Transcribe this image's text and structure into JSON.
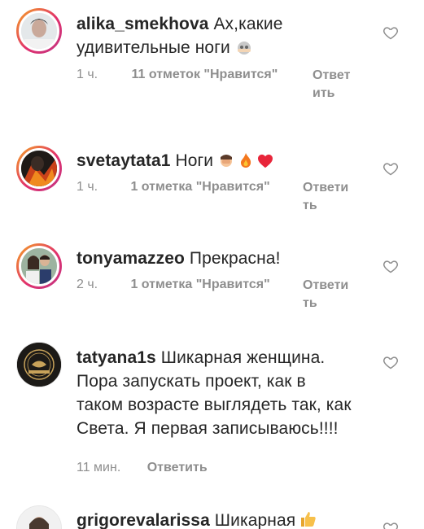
{
  "comments": [
    {
      "username": "alika_smekhova",
      "text": "Ах,какие удивительные ноги",
      "time": "1 ч.",
      "likes": "11 отметок \"Нравится\"",
      "reply": "Ответить"
    },
    {
      "username": "svetaytata1",
      "text": "Ноги",
      "time": "1 ч.",
      "likes": "1 отметка \"Нравится\"",
      "reply": "Ответить"
    },
    {
      "username": "tonyamazzeo",
      "text": "Прекрасна!",
      "time": "2 ч.",
      "likes": "1 отметка \"Нравится\"",
      "reply": "Ответить"
    },
    {
      "username": "tatyana1s",
      "text": "Шикарная женщина. Пора запускать проект, как в таком возрасте выглядеть так, как Света. Я первая записываюсь!!!!",
      "time": "11 мин.",
      "reply": "Ответить"
    },
    {
      "username": "grigorevalarissa",
      "text": "Шикарная"
    }
  ],
  "icons": {
    "heart": "heart-outline-icon",
    "accent_gradient": [
      "#f5a623",
      "#e1306c",
      "#c13584"
    ],
    "meta_color": "#8e8e8e"
  }
}
